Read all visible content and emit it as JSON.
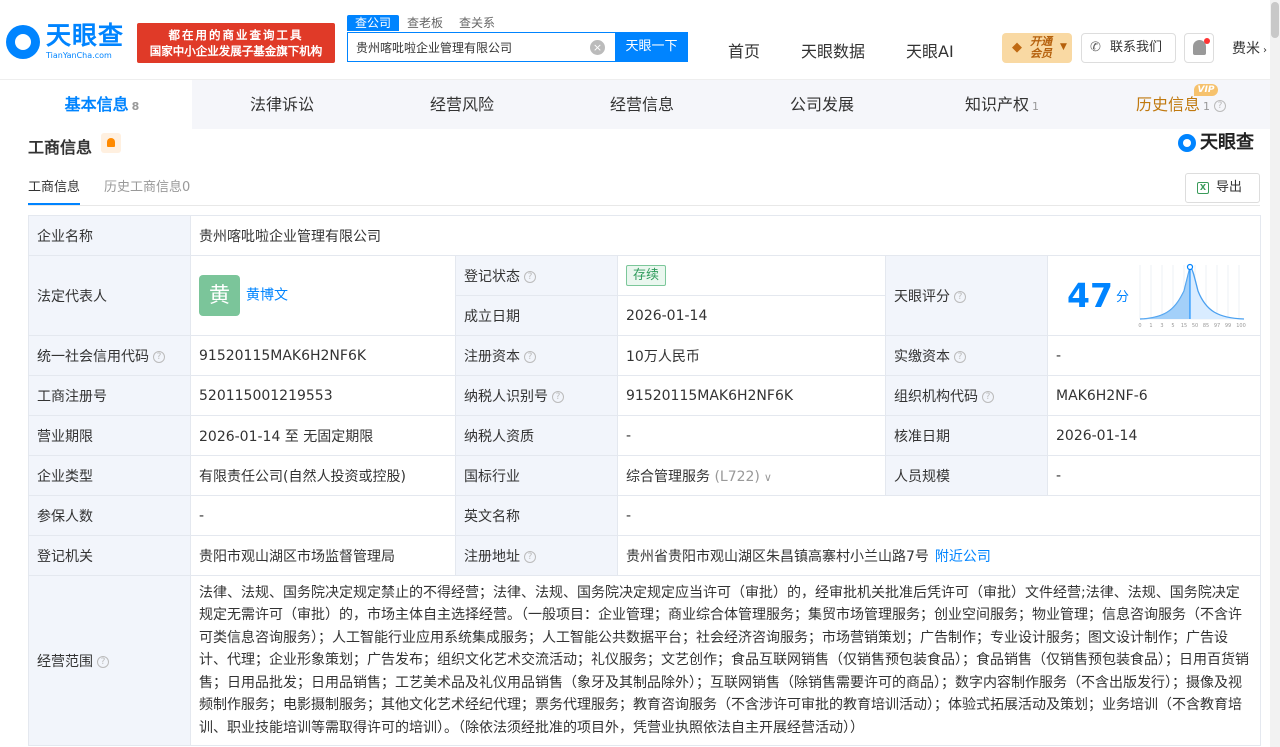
{
  "header": {
    "logo_text": "天眼查",
    "logo_sub": "TianYanCha.com",
    "promo_line1": "都在用的商业查询工具",
    "promo_line2": "国家中小企业发展子基金旗下机构",
    "search_tabs": [
      "查公司",
      "查老板",
      "查关系"
    ],
    "search_value": "贵州喀吡啦企业管理有限公司",
    "search_button": "天眼一下",
    "nav": [
      "首页",
      "天眼数据",
      "天眼AI"
    ],
    "vip_line1": "开通",
    "vip_line2": "会员",
    "contact": "联系我们",
    "user": "费米"
  },
  "main_tabs": [
    {
      "label": "基本信息",
      "count": "8"
    },
    {
      "label": "法律诉讼",
      "count": ""
    },
    {
      "label": "经营风险",
      "count": ""
    },
    {
      "label": "经营信息",
      "count": ""
    },
    {
      "label": "公司发展",
      "count": ""
    },
    {
      "label": "知识产权",
      "count": "1"
    },
    {
      "label": "历史信息",
      "count": "1",
      "vip_tag": "VIP"
    }
  ],
  "section": {
    "title": "工商信息",
    "watermark": "天眼查",
    "sub_tabs": [
      "工商信息",
      "历史工商信息0"
    ],
    "export": "导出"
  },
  "info": {
    "labels": {
      "company_name": "企业名称",
      "legal_rep": "法定代表人",
      "reg_status": "登记状态",
      "est_date": "成立日期",
      "tianyan_score": "天眼评分",
      "credit_code": "统一社会信用代码",
      "reg_capital": "注册资本",
      "paid_capital": "实缴资本",
      "reg_no": "工商注册号",
      "taxpayer_id": "纳税人识别号",
      "org_code": "组织机构代码",
      "term": "营业期限",
      "taxpayer_quality": "纳税人资质",
      "approve_date": "核准日期",
      "company_type": "企业类型",
      "industry": "国标行业",
      "staff_size": "人员规模",
      "insured": "参保人数",
      "english_name": "英文名称",
      "reg_authority": "登记机关",
      "reg_address": "注册地址",
      "scope": "经营范围"
    },
    "values": {
      "company_name": "贵州喀吡啦企业管理有限公司",
      "legal_rep_avatar": "黄",
      "legal_rep": "黄博文",
      "reg_status": "存续",
      "est_date": "2026-01-14",
      "score": "47",
      "score_unit": "分",
      "credit_code": "91520115MAK6H2NF6K",
      "reg_capital": "10万人民币",
      "paid_capital": "-",
      "reg_no": "520115001219553",
      "taxpayer_id": "91520115MAK6H2NF6K",
      "org_code": "MAK6H2NF-6",
      "term": "2026-01-14 至 无固定期限",
      "taxpayer_quality": "-",
      "approve_date": "2026-01-14",
      "company_type": "有限责任公司(自然人投资或控股)",
      "industry": "综合管理服务",
      "industry_code": "(L722)",
      "staff_size": "-",
      "insured": "-",
      "english_name": "-",
      "reg_authority": "贵阳市观山湖区市场监督管理局",
      "reg_address": "贵州省贵阳市观山湖区朱昌镇高寨村小兰山路7号",
      "nearby_link": "附近公司",
      "scope": "法律、法规、国务院决定规定禁止的不得经营；法律、法规、国务院决定规定应当许可（审批）的，经审批机关批准后凭许可（审批）文件经营;法律、法规、国务院决定规定无需许可（审批）的，市场主体自主选择经营。（一般项目：企业管理；商业综合体管理服务；集贸市场管理服务；创业空间服务；物业管理；信息咨询服务（不含许可类信息咨询服务）；人工智能行业应用系统集成服务；人工智能公共数据平台；社会经济咨询服务；市场营销策划；广告制作；专业设计服务；图文设计制作；广告设计、代理；企业形象策划；广告发布；组织文化艺术交流活动；礼仪服务；文艺创作；食品互联网销售（仅销售预包装食品）；食品销售（仅销售预包装食品）；日用百货销售；日用品批发；日用品销售；工艺美术品及礼仪用品销售（象牙及其制品除外）；互联网销售（除销售需要许可的商品）；数字内容制作服务（不含出版发行）；摄像及视频制作服务；电影摄制服务；其他文化艺术经纪代理；票务代理服务；教育咨询服务（不含涉许可审批的教育培训活动）；体验式拓展活动及策划；业务培训（不含教育培训、职业技能培训等需取得许可的培训）。（除依法须经批准的项目外，凭营业执照依法自主开展经营活动））"
    },
    "score_axis_ticks": [
      "0",
      "1",
      "3",
      "5",
      "15",
      "50",
      "85",
      "97",
      "99",
      "100"
    ]
  }
}
